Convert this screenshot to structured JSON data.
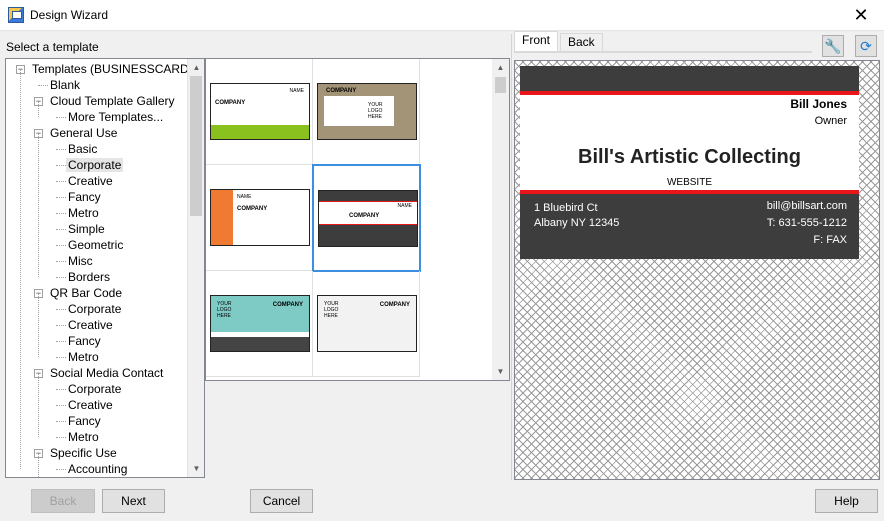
{
  "window": {
    "title": "Design Wizard",
    "close": "✕"
  },
  "left": {
    "label": "Select a template"
  },
  "tree": [
    {
      "label": "Templates (BUSINESSCARD)",
      "level": 0,
      "expander": "−"
    },
    {
      "label": "Blank",
      "level": 1
    },
    {
      "label": "Cloud Template Gallery",
      "level": 1,
      "expander": "−"
    },
    {
      "label": "More Templates...",
      "level": 2
    },
    {
      "label": "General Use",
      "level": 1,
      "expander": "−"
    },
    {
      "label": "Basic",
      "level": 2
    },
    {
      "label": "Corporate",
      "level": 2,
      "selected": true
    },
    {
      "label": "Creative",
      "level": 2
    },
    {
      "label": "Fancy",
      "level": 2
    },
    {
      "label": "Metro",
      "level": 2
    },
    {
      "label": "Simple",
      "level": 2
    },
    {
      "label": "Geometric",
      "level": 2
    },
    {
      "label": "Misc",
      "level": 2
    },
    {
      "label": "Borders",
      "level": 2
    },
    {
      "label": "QR Bar Code",
      "level": 1,
      "expander": "−"
    },
    {
      "label": "Corporate",
      "level": 2
    },
    {
      "label": "Creative",
      "level": 2
    },
    {
      "label": "Fancy",
      "level": 2
    },
    {
      "label": "Metro",
      "level": 2
    },
    {
      "label": "Social Media Contact",
      "level": 1,
      "expander": "−"
    },
    {
      "label": "Corporate",
      "level": 2
    },
    {
      "label": "Creative",
      "level": 2
    },
    {
      "label": "Fancy",
      "level": 2
    },
    {
      "label": "Metro",
      "level": 2
    },
    {
      "label": "Specific Use",
      "level": 1,
      "expander": "−"
    },
    {
      "label": "Accounting",
      "level": 2
    }
  ],
  "thumbnails": [
    {
      "company": "COMPANY",
      "name": "NAME",
      "style": "green",
      "col": 0,
      "row": 0
    },
    {
      "company": "COMPANY",
      "logo": "YOUR LOGO HERE",
      "style": "tan",
      "col": 1,
      "row": 0
    },
    {
      "company": "COMPANY",
      "name": "NAME",
      "style": "orange",
      "col": 0,
      "row": 1
    },
    {
      "company": "COMPANY",
      "name": "NAME",
      "style": "dark",
      "col": 1,
      "row": 1,
      "selected": true
    },
    {
      "company": "COMPANY",
      "logo": "YOUR LOGO HERE",
      "style": "teal",
      "col": 0,
      "row": 2
    },
    {
      "company": "COMPANY",
      "logo": "YOUR LOGO HERE",
      "style": "gray",
      "col": 1,
      "row": 2
    }
  ],
  "tabs": {
    "front": "Front",
    "back": "Back"
  },
  "tools": {
    "settings_icon": "wrench-icon",
    "refresh_icon": "refresh-icon"
  },
  "card": {
    "name": "Bill Jones",
    "title": "Owner",
    "company": "Bill's Artistic Collecting",
    "website": "WEBSITE",
    "address1": "1 Bluebird Ct",
    "address2": "Albany NY 12345",
    "email": "bill@billsart.com",
    "phone": "T: 631-555-1212",
    "fax": "F: FAX",
    "colors": {
      "dark": "#3d3d3d",
      "accent": "#e8161b"
    }
  },
  "buttons": {
    "back": "Back",
    "next": "Next",
    "cancel": "Cancel",
    "help": "Help"
  }
}
